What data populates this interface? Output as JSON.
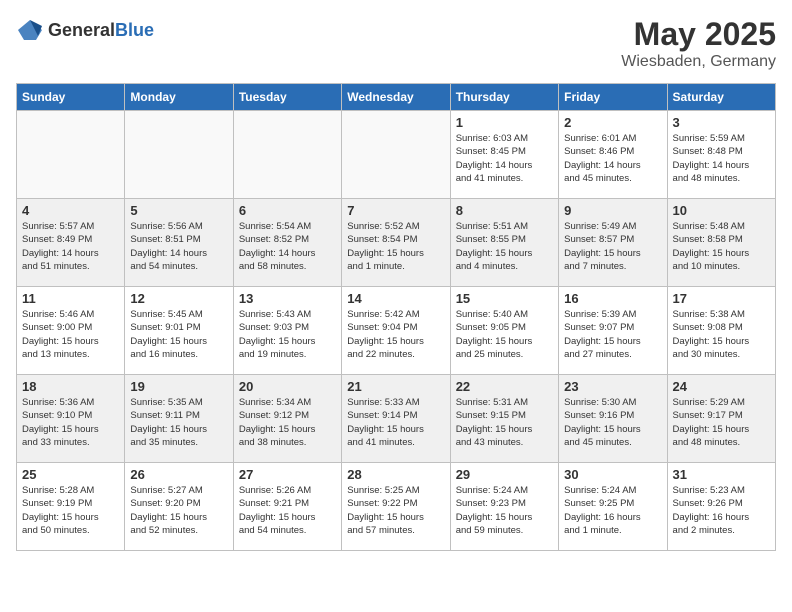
{
  "header": {
    "logo_general": "General",
    "logo_blue": "Blue",
    "month": "May 2025",
    "location": "Wiesbaden, Germany"
  },
  "days_of_week": [
    "Sunday",
    "Monday",
    "Tuesday",
    "Wednesday",
    "Thursday",
    "Friday",
    "Saturday"
  ],
  "weeks": [
    [
      {
        "day": "",
        "info": ""
      },
      {
        "day": "",
        "info": ""
      },
      {
        "day": "",
        "info": ""
      },
      {
        "day": "",
        "info": ""
      },
      {
        "day": "1",
        "info": "Sunrise: 6:03 AM\nSunset: 8:45 PM\nDaylight: 14 hours\nand 41 minutes."
      },
      {
        "day": "2",
        "info": "Sunrise: 6:01 AM\nSunset: 8:46 PM\nDaylight: 14 hours\nand 45 minutes."
      },
      {
        "day": "3",
        "info": "Sunrise: 5:59 AM\nSunset: 8:48 PM\nDaylight: 14 hours\nand 48 minutes."
      }
    ],
    [
      {
        "day": "4",
        "info": "Sunrise: 5:57 AM\nSunset: 8:49 PM\nDaylight: 14 hours\nand 51 minutes."
      },
      {
        "day": "5",
        "info": "Sunrise: 5:56 AM\nSunset: 8:51 PM\nDaylight: 14 hours\nand 54 minutes."
      },
      {
        "day": "6",
        "info": "Sunrise: 5:54 AM\nSunset: 8:52 PM\nDaylight: 14 hours\nand 58 minutes."
      },
      {
        "day": "7",
        "info": "Sunrise: 5:52 AM\nSunset: 8:54 PM\nDaylight: 15 hours\nand 1 minute."
      },
      {
        "day": "8",
        "info": "Sunrise: 5:51 AM\nSunset: 8:55 PM\nDaylight: 15 hours\nand 4 minutes."
      },
      {
        "day": "9",
        "info": "Sunrise: 5:49 AM\nSunset: 8:57 PM\nDaylight: 15 hours\nand 7 minutes."
      },
      {
        "day": "10",
        "info": "Sunrise: 5:48 AM\nSunset: 8:58 PM\nDaylight: 15 hours\nand 10 minutes."
      }
    ],
    [
      {
        "day": "11",
        "info": "Sunrise: 5:46 AM\nSunset: 9:00 PM\nDaylight: 15 hours\nand 13 minutes."
      },
      {
        "day": "12",
        "info": "Sunrise: 5:45 AM\nSunset: 9:01 PM\nDaylight: 15 hours\nand 16 minutes."
      },
      {
        "day": "13",
        "info": "Sunrise: 5:43 AM\nSunset: 9:03 PM\nDaylight: 15 hours\nand 19 minutes."
      },
      {
        "day": "14",
        "info": "Sunrise: 5:42 AM\nSunset: 9:04 PM\nDaylight: 15 hours\nand 22 minutes."
      },
      {
        "day": "15",
        "info": "Sunrise: 5:40 AM\nSunset: 9:05 PM\nDaylight: 15 hours\nand 25 minutes."
      },
      {
        "day": "16",
        "info": "Sunrise: 5:39 AM\nSunset: 9:07 PM\nDaylight: 15 hours\nand 27 minutes."
      },
      {
        "day": "17",
        "info": "Sunrise: 5:38 AM\nSunset: 9:08 PM\nDaylight: 15 hours\nand 30 minutes."
      }
    ],
    [
      {
        "day": "18",
        "info": "Sunrise: 5:36 AM\nSunset: 9:10 PM\nDaylight: 15 hours\nand 33 minutes."
      },
      {
        "day": "19",
        "info": "Sunrise: 5:35 AM\nSunset: 9:11 PM\nDaylight: 15 hours\nand 35 minutes."
      },
      {
        "day": "20",
        "info": "Sunrise: 5:34 AM\nSunset: 9:12 PM\nDaylight: 15 hours\nand 38 minutes."
      },
      {
        "day": "21",
        "info": "Sunrise: 5:33 AM\nSunset: 9:14 PM\nDaylight: 15 hours\nand 41 minutes."
      },
      {
        "day": "22",
        "info": "Sunrise: 5:31 AM\nSunset: 9:15 PM\nDaylight: 15 hours\nand 43 minutes."
      },
      {
        "day": "23",
        "info": "Sunrise: 5:30 AM\nSunset: 9:16 PM\nDaylight: 15 hours\nand 45 minutes."
      },
      {
        "day": "24",
        "info": "Sunrise: 5:29 AM\nSunset: 9:17 PM\nDaylight: 15 hours\nand 48 minutes."
      }
    ],
    [
      {
        "day": "25",
        "info": "Sunrise: 5:28 AM\nSunset: 9:19 PM\nDaylight: 15 hours\nand 50 minutes."
      },
      {
        "day": "26",
        "info": "Sunrise: 5:27 AM\nSunset: 9:20 PM\nDaylight: 15 hours\nand 52 minutes."
      },
      {
        "day": "27",
        "info": "Sunrise: 5:26 AM\nSunset: 9:21 PM\nDaylight: 15 hours\nand 54 minutes."
      },
      {
        "day": "28",
        "info": "Sunrise: 5:25 AM\nSunset: 9:22 PM\nDaylight: 15 hours\nand 57 minutes."
      },
      {
        "day": "29",
        "info": "Sunrise: 5:24 AM\nSunset: 9:23 PM\nDaylight: 15 hours\nand 59 minutes."
      },
      {
        "day": "30",
        "info": "Sunrise: 5:24 AM\nSunset: 9:25 PM\nDaylight: 16 hours\nand 1 minute."
      },
      {
        "day": "31",
        "info": "Sunrise: 5:23 AM\nSunset: 9:26 PM\nDaylight: 16 hours\nand 2 minutes."
      }
    ]
  ]
}
